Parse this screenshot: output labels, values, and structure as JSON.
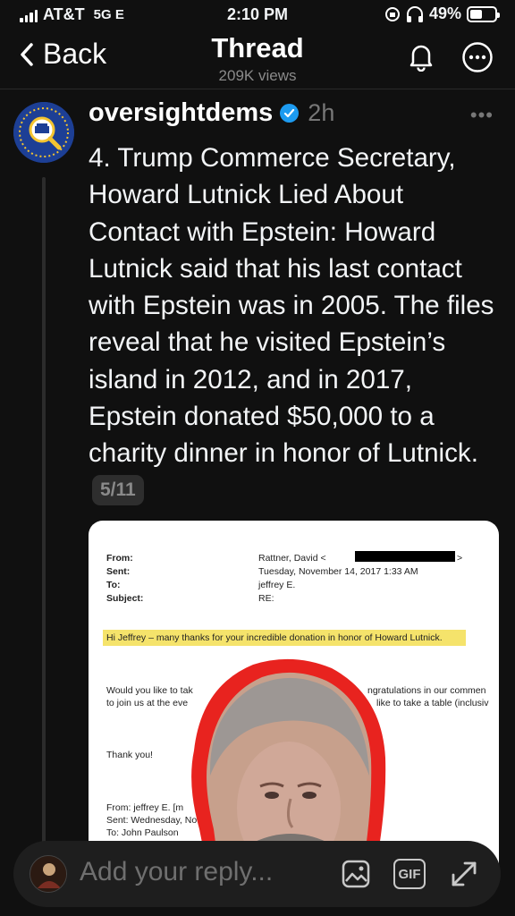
{
  "status_bar": {
    "carrier": "AT&T",
    "network": "5G E",
    "time": "2:10 PM",
    "battery": "49%",
    "battery_level": 0.49
  },
  "nav": {
    "back_label": "Back",
    "title": "Thread",
    "subtitle": "209K views"
  },
  "post": {
    "username": "oversightdems",
    "timestamp": "2h",
    "text": "4. Trump Commerce Secretary, Howard Lutnick Lied About Contact with Epstein: Howard Lutnick said that his last contact with Epstein was in 2005. The files reveal that he visited Epstein’s island in 2012, and in 2017, Epstein donated $50,000 to a charity dinner in honor of Lutnick.",
    "counter": "5/11"
  },
  "document": {
    "from_label": "From:",
    "sent_label": "Sent:",
    "to_label": "To:",
    "subject_label": "Subject:",
    "from_value": "Rattner, David <",
    "from_close": ">",
    "sent_value": "Tuesday, November 14, 2017 1:33 AM",
    "to_value": "jeffrey E.",
    "subject_value": "RE:",
    "highlight_text": "Hi Jeffrey – many thanks for your incredible donation in honor of Howard Lutnick.",
    "line1_left": "Would you like to tak",
    "line1_right": "ngratulations in our commen",
    "line2_left": "to join us at the eve",
    "line2_right": "like to take a table (inclusiv",
    "thanks": "Thank you!",
    "fwd_from": "From: jeffrey E. [m",
    "fwd_sent": "Sent: Wednesday, No",
    "fwd_to": "To: John Paulson"
  },
  "reply": {
    "placeholder": "Add your reply...",
    "gif_label": "GIF"
  },
  "colors": {
    "background": "#101010",
    "verified": "#1d9bf0",
    "highlight": "#f5e36b",
    "outline": "#e8231f"
  }
}
